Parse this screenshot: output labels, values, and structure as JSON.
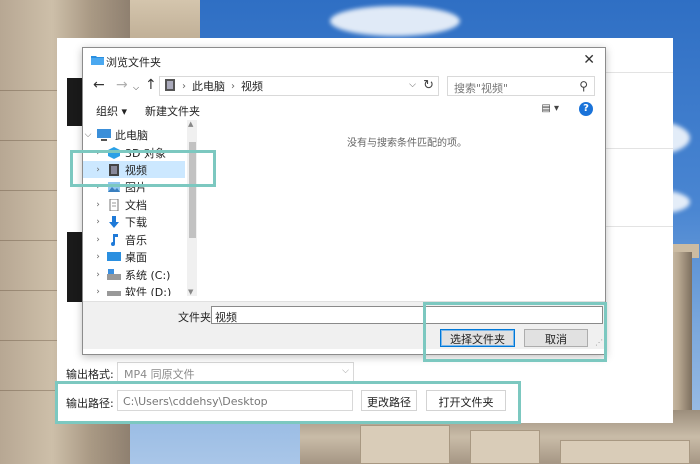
{
  "dialog": {
    "title": "浏览文件夹",
    "close_icon": "close-icon",
    "breadcrumb": [
      "此电脑",
      "视频"
    ],
    "search_placeholder": "搜索\"视频\"",
    "toolbar": {
      "organize": "组织 ▾",
      "new_folder": "新建文件夹"
    },
    "tree": [
      {
        "label": "此电脑",
        "icon": "computer-icon",
        "expanded": true
      },
      {
        "label": "3D 对象",
        "icon": "cube-icon"
      },
      {
        "label": "视频",
        "icon": "video-icon",
        "selected": true
      },
      {
        "label": "图片",
        "icon": "picture-icon"
      },
      {
        "label": "文档",
        "icon": "document-icon"
      },
      {
        "label": "下载",
        "icon": "download-icon"
      },
      {
        "label": "音乐",
        "icon": "music-icon"
      },
      {
        "label": "桌面",
        "icon": "desktop-icon"
      },
      {
        "label": "系统 (C:)",
        "icon": "drive-icon"
      },
      {
        "label": "软件 (D:)",
        "icon": "drive-icon"
      }
    ],
    "empty_message": "没有与搜索条件匹配的项。",
    "folder_label": "文件夹:",
    "folder_value": "视频",
    "select_button": "选择文件夹",
    "cancel_button": "取消"
  },
  "app": {
    "format_label": "输出格式:",
    "format_value": "MP4  同原文件",
    "path_label": "输出路径:",
    "path_value": "C:\\Users\\cddehsy\\Desktop",
    "change_path_button": "更改路径",
    "open_folder_button": "打开文件夹"
  },
  "colors": {
    "highlight": "#7cc8c0",
    "selection": "#cce8ff",
    "accent": "#0078d7"
  }
}
